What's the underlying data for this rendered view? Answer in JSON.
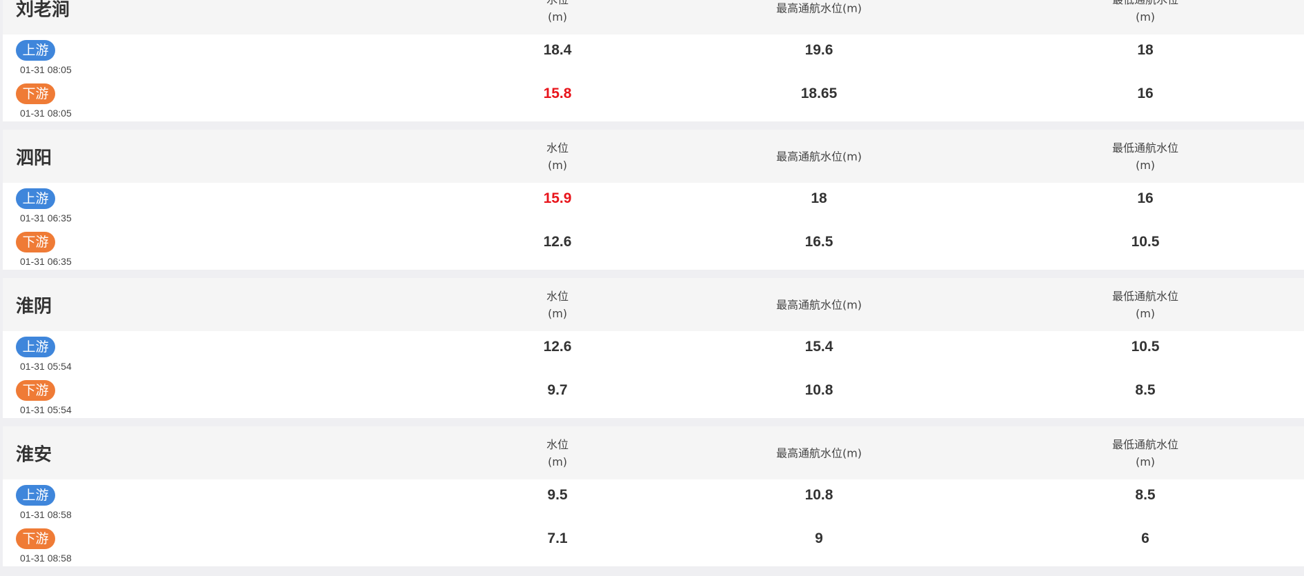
{
  "colors": {
    "upstream": "#3f86db",
    "downstream": "#ef7b36",
    "warning": "#e8141b"
  },
  "stations": [
    {
      "name": "刘老涧",
      "headers": {
        "level": [
          "水位",
          "(m)"
        ],
        "max": [
          "最高通航水位(m)"
        ],
        "min": [
          "最低通航水位",
          "(m)"
        ]
      },
      "rows": [
        {
          "tag": "上游",
          "kind": "up",
          "time": "01-31 08:05",
          "level": "18.4",
          "level_warn": false,
          "max": "19.6",
          "min": "18"
        },
        {
          "tag": "下游",
          "kind": "down",
          "time": "01-31 08:05",
          "level": "15.8",
          "level_warn": true,
          "max": "18.65",
          "min": "16"
        }
      ]
    },
    {
      "name": "泗阳",
      "headers": {
        "level": [
          "水位",
          "(m)"
        ],
        "max": [
          "最高通航水位(m)"
        ],
        "min": [
          "最低通航水位",
          "(m)"
        ]
      },
      "rows": [
        {
          "tag": "上游",
          "kind": "up",
          "time": "01-31 06:35",
          "level": "15.9",
          "level_warn": true,
          "max": "18",
          "min": "16"
        },
        {
          "tag": "下游",
          "kind": "down",
          "time": "01-31 06:35",
          "level": "12.6",
          "level_warn": false,
          "max": "16.5",
          "min": "10.5"
        }
      ]
    },
    {
      "name": "淮阴",
      "headers": {
        "level": [
          "水位",
          "(m)"
        ],
        "max": [
          "最高通航水位(m)"
        ],
        "min": [
          "最低通航水位",
          "(m)"
        ]
      },
      "rows": [
        {
          "tag": "上游",
          "kind": "up",
          "time": "01-31 05:54",
          "level": "12.6",
          "level_warn": false,
          "max": "15.4",
          "min": "10.5"
        },
        {
          "tag": "下游",
          "kind": "down",
          "time": "01-31 05:54",
          "level": "9.7",
          "level_warn": false,
          "max": "10.8",
          "min": "8.5"
        }
      ]
    },
    {
      "name": "淮安",
      "headers": {
        "level": [
          "水位",
          "(m)"
        ],
        "max": [
          "最高通航水位(m)"
        ],
        "min": [
          "最低通航水位",
          "(m)"
        ]
      },
      "rows": [
        {
          "tag": "上游",
          "kind": "up",
          "time": "01-31 08:58",
          "level": "9.5",
          "level_warn": false,
          "max": "10.8",
          "min": "8.5"
        },
        {
          "tag": "下游",
          "kind": "down",
          "time": "01-31 08:58",
          "level": "7.1",
          "level_warn": false,
          "max": "9",
          "min": "6"
        }
      ]
    }
  ]
}
